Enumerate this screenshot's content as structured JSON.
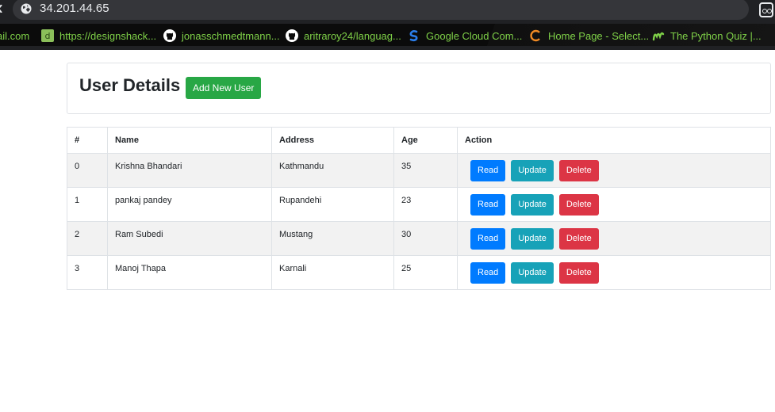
{
  "browser": {
    "url": "34.201.44.65",
    "bookmarks": [
      {
        "label": "ail.com",
        "icon": "mail-icon"
      },
      {
        "label": "https://designshack...",
        "icon": "designshack-icon"
      },
      {
        "label": "jonasschmedtmann...",
        "icon": "github-icon"
      },
      {
        "label": "aritraroy24/languag...",
        "icon": "github-icon"
      },
      {
        "label": "Google Cloud Com...",
        "icon": "google-cloud-icon"
      },
      {
        "label": "Home Page - Select...",
        "icon": "home-page-icon"
      },
      {
        "label": "The Python Quiz |...",
        "icon": "python-quiz-icon"
      }
    ],
    "colors": {
      "bookmark_text": "#7fd148",
      "chrome_bg": "#202124"
    }
  },
  "page": {
    "title": "User Details",
    "add_button_label": "Add New User",
    "table": {
      "headers": [
        "#",
        "Name",
        "Address",
        "Age",
        "Action"
      ],
      "rows": [
        {
          "id": "0",
          "name": "Krishna Bhandari",
          "address": "Kathmandu",
          "age": "35"
        },
        {
          "id": "1",
          "name": "pankaj pandey",
          "address": "Rupandehi",
          "age": "23"
        },
        {
          "id": "2",
          "name": "Ram Subedi",
          "address": "Mustang",
          "age": "30"
        },
        {
          "id": "3",
          "name": "Manoj Thapa",
          "address": "Karnali",
          "age": "25"
        }
      ],
      "actions": {
        "read": "Read",
        "update": "Update",
        "delete": "Delete"
      }
    },
    "colors": {
      "success": "#28a745",
      "primary": "#007bff",
      "info": "#17a2b8",
      "danger": "#dc3545"
    }
  }
}
